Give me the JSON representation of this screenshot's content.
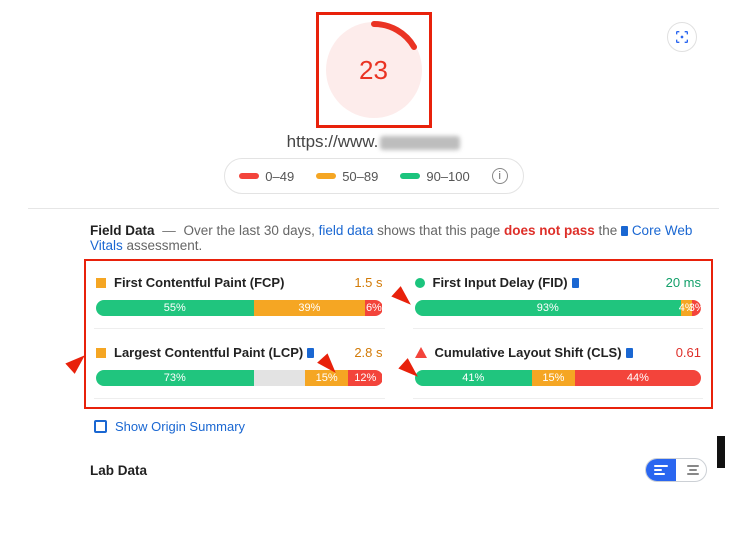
{
  "score": "23",
  "url_prefix": "https://www.",
  "legend": {
    "poor": "0–49",
    "mid": "50–89",
    "good": "90–100"
  },
  "field": {
    "title": "Field Data",
    "lead_before": "Over the last 30 days, ",
    "link_field_data": "field data",
    "lead_mid": " shows that this page ",
    "fail_text": "does not pass",
    "lead_after": " the ",
    "cwv_link": "Core Web Vitals",
    "assessment": " assessment."
  },
  "metrics": {
    "fcp": {
      "label": "First Contentful Paint (FCP)",
      "value": "1.5 s",
      "dist": {
        "green": "55%",
        "orange": "39%",
        "red": "6%"
      }
    },
    "fid": {
      "label": "First Input Delay (FID)",
      "value": "20 ms",
      "dist": {
        "green": "93%",
        "orange": "4%",
        "red": "3%"
      }
    },
    "lcp": {
      "label": "Largest Contentful Paint (LCP)",
      "value": "2.8 s",
      "dist": {
        "green": "73%",
        "orange": "15%",
        "red": "12%"
      }
    },
    "cls": {
      "label": "Cumulative Layout Shift (CLS)",
      "value": "0.61",
      "dist": {
        "green": "41%",
        "orange": "15%",
        "red": "44%"
      }
    }
  },
  "origin_toggle": "Show Origin Summary",
  "lab_title": "Lab Data"
}
